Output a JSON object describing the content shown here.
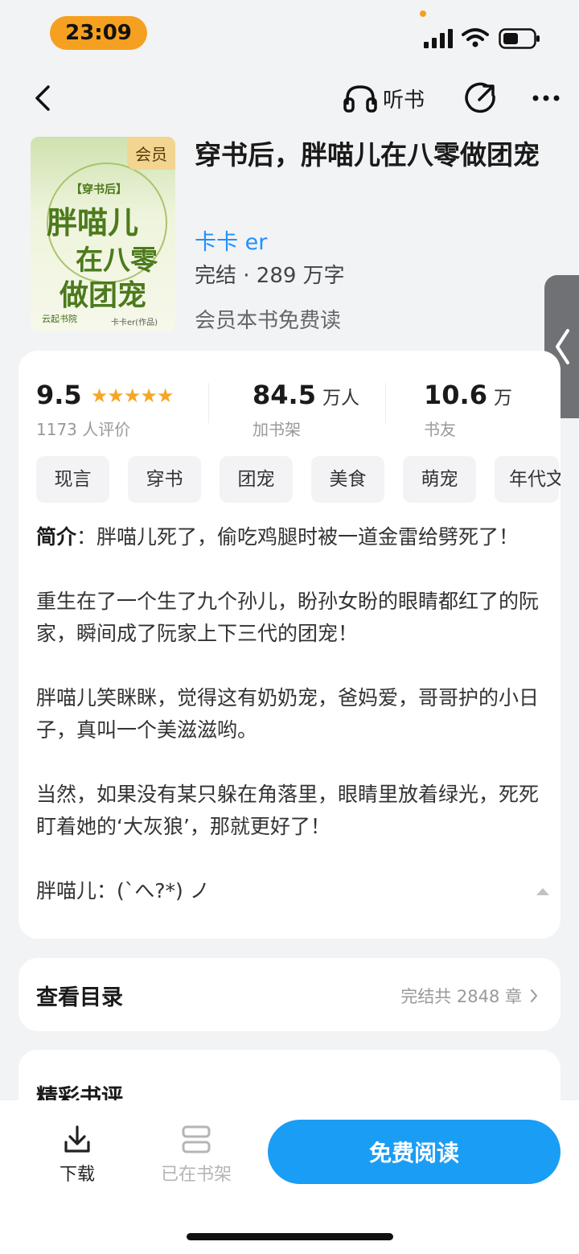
{
  "status_bar": {
    "time": "23:09"
  },
  "nav": {
    "listen_label": "听书"
  },
  "book": {
    "cover_badge": "会员",
    "cover_small_title": "【穿书后】",
    "cover_line1": "胖喵儿",
    "cover_line2": "在八零",
    "cover_line3": "做团宠",
    "cover_publisher": "云起书院",
    "cover_author": "卡卡er(作品)",
    "title": "穿书后，胖喵儿在八零做团宠",
    "author": "卡卡 er",
    "status": "完结 · 289 万字",
    "vip_note": "会员本书免费读"
  },
  "stats": {
    "rating": "9.5",
    "rating_count": "1173 人评价",
    "shelf_num": "84.5",
    "shelf_unit": "万人",
    "shelf_label": "加书架",
    "fans_num": "10.6",
    "fans_unit": "万",
    "fans_label": "书友"
  },
  "tags": [
    "现言",
    "穿书",
    "团宠",
    "美食",
    "萌宠",
    "年代文"
  ],
  "intro": {
    "label": "简介",
    "p1": "：胖喵儿死了，偷吃鸡腿时被一道金雷给劈死了！",
    "p2": "重生在了一个生了九个孙儿，盼孙女盼的眼睛都红了的阮家，瞬间成了阮家上下三代的团宠！",
    "p3": "胖喵儿笑眯眯，觉得这有奶奶宠，爸妈爱，哥哥护的小日子，真叫一个美滋滋哟。",
    "p4": "当然，如果没有某只躲在角落里，眼睛里放着绿光，死死盯着她的‘大灰狼’，那就更好了！",
    "p5": "胖喵儿：(`へ?*) ノ"
  },
  "toc": {
    "title": "查看目录",
    "meta": "完结共 2848 章"
  },
  "reviews": {
    "title": "精彩书评"
  },
  "bottom": {
    "download_label": "下载",
    "shelf_label": "已在书架",
    "read_label": "免费阅读"
  },
  "colors": {
    "accent": "#1a9df5",
    "author_link": "#1e90ff",
    "time_pill": "#f5a020",
    "star": "#f5a623"
  }
}
